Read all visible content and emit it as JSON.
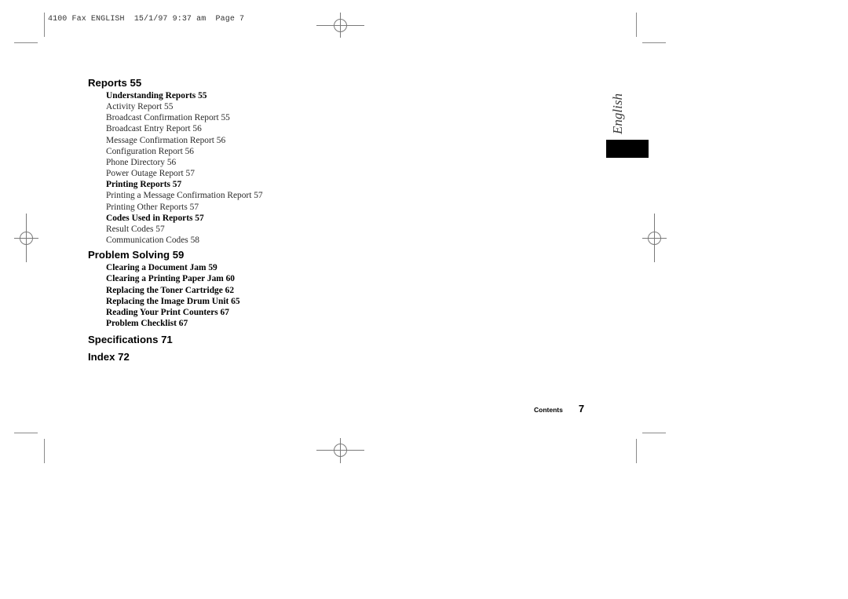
{
  "slug": {
    "text": "4100 Fax ENGLISH  15/1/97 9:37 am  Page 7"
  },
  "side_tab": {
    "label": "English",
    "tab_color": "#000000"
  },
  "toc": {
    "sections": [
      {
        "title": "Reports 55",
        "entries": [
          {
            "text": "Understanding Reports 55",
            "bold": true
          },
          {
            "text": "Activity Report 55",
            "bold": false
          },
          {
            "text": "Broadcast Confirmation Report 55",
            "bold": false
          },
          {
            "text": "Broadcast Entry Report 56",
            "bold": false
          },
          {
            "text": "Message Confirmation Report 56",
            "bold": false
          },
          {
            "text": "Configuration Report 56",
            "bold": false
          },
          {
            "text": "Phone Directory 56",
            "bold": false
          },
          {
            "text": "Power Outage Report 57",
            "bold": false
          },
          {
            "text": "Printing Reports 57",
            "bold": true
          },
          {
            "text": "Printing a Message Confirmation Report 57",
            "bold": false
          },
          {
            "text": "Printing Other Reports 57",
            "bold": false
          },
          {
            "text": "Codes Used in Reports 57",
            "bold": true
          },
          {
            "text": "Result Codes 57",
            "bold": false
          },
          {
            "text": "Communication Codes 58",
            "bold": false
          }
        ]
      },
      {
        "title": "Problem Solving 59",
        "entries": [
          {
            "text": "Clearing a Document Jam 59",
            "bold": true
          },
          {
            "text": "Clearing a Printing Paper Jam 60",
            "bold": true
          },
          {
            "text": "Replacing the Toner Cartridge 62",
            "bold": true
          },
          {
            "text": "Replacing the Image Drum Unit 65",
            "bold": true
          },
          {
            "text": "Reading Your Print Counters 67",
            "bold": true
          },
          {
            "text": "Problem Checklist 67",
            "bold": true
          }
        ]
      },
      {
        "title": "Specifications 71",
        "entries": []
      },
      {
        "title": "Index 72",
        "entries": []
      }
    ]
  },
  "footer": {
    "label": "Contents",
    "page_number": "7"
  },
  "marks": {
    "crop_mark_color": "#8a8a8a",
    "registration_mark_color": "#7a7a7a"
  }
}
